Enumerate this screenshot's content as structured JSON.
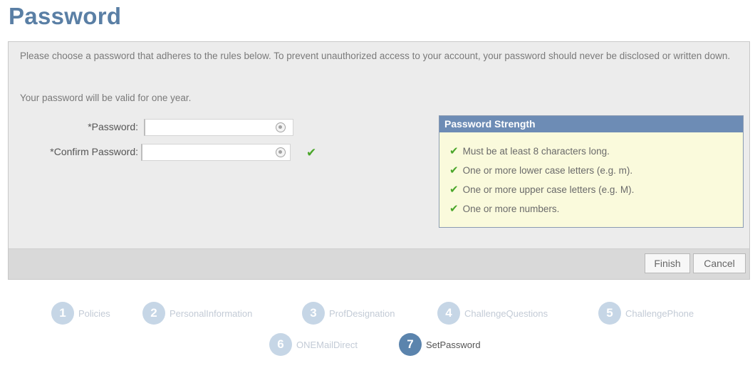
{
  "page": {
    "title": "Password",
    "intro": "Please choose a password that adheres to the rules below. To prevent unauthorized access to your account, your password should never be disclosed or written down.",
    "validity": "Your password will be valid for one year."
  },
  "form": {
    "password_label": "*Password:",
    "password_value": "",
    "confirm_label": "*Confirm Password:",
    "confirm_value": "",
    "confirm_matches": true
  },
  "strength": {
    "title": "Password Strength",
    "rules": [
      {
        "text": "Must be at least 8 characters long.",
        "met": true
      },
      {
        "text": "One or more lower case letters (e.g. m).",
        "met": true
      },
      {
        "text": "One or more upper case letters (e.g. M).",
        "met": true
      },
      {
        "text": "One or more numbers.",
        "met": true
      }
    ]
  },
  "buttons": {
    "finish": "Finish",
    "cancel": "Cancel"
  },
  "steps": [
    {
      "number": "1",
      "label": "Policies",
      "active": false
    },
    {
      "number": "2",
      "label": "PersonalInformation",
      "active": false
    },
    {
      "number": "3",
      "label": "ProfDesignation",
      "active": false
    },
    {
      "number": "4",
      "label": "ChallengeQuestions",
      "active": false
    },
    {
      "number": "5",
      "label": "ChallengePhone",
      "active": false
    },
    {
      "number": "6",
      "label": "ONEMailDirect",
      "active": false
    },
    {
      "number": "7",
      "label": "SetPassword",
      "active": true
    }
  ],
  "colors": {
    "title": "#5a7fa5",
    "strength_header": "#6d8cb5",
    "strength_bg": "#fafadc",
    "check": "#4aa62a",
    "active_step": "#5b84ad",
    "inactive_step": "#c6d6e6"
  }
}
